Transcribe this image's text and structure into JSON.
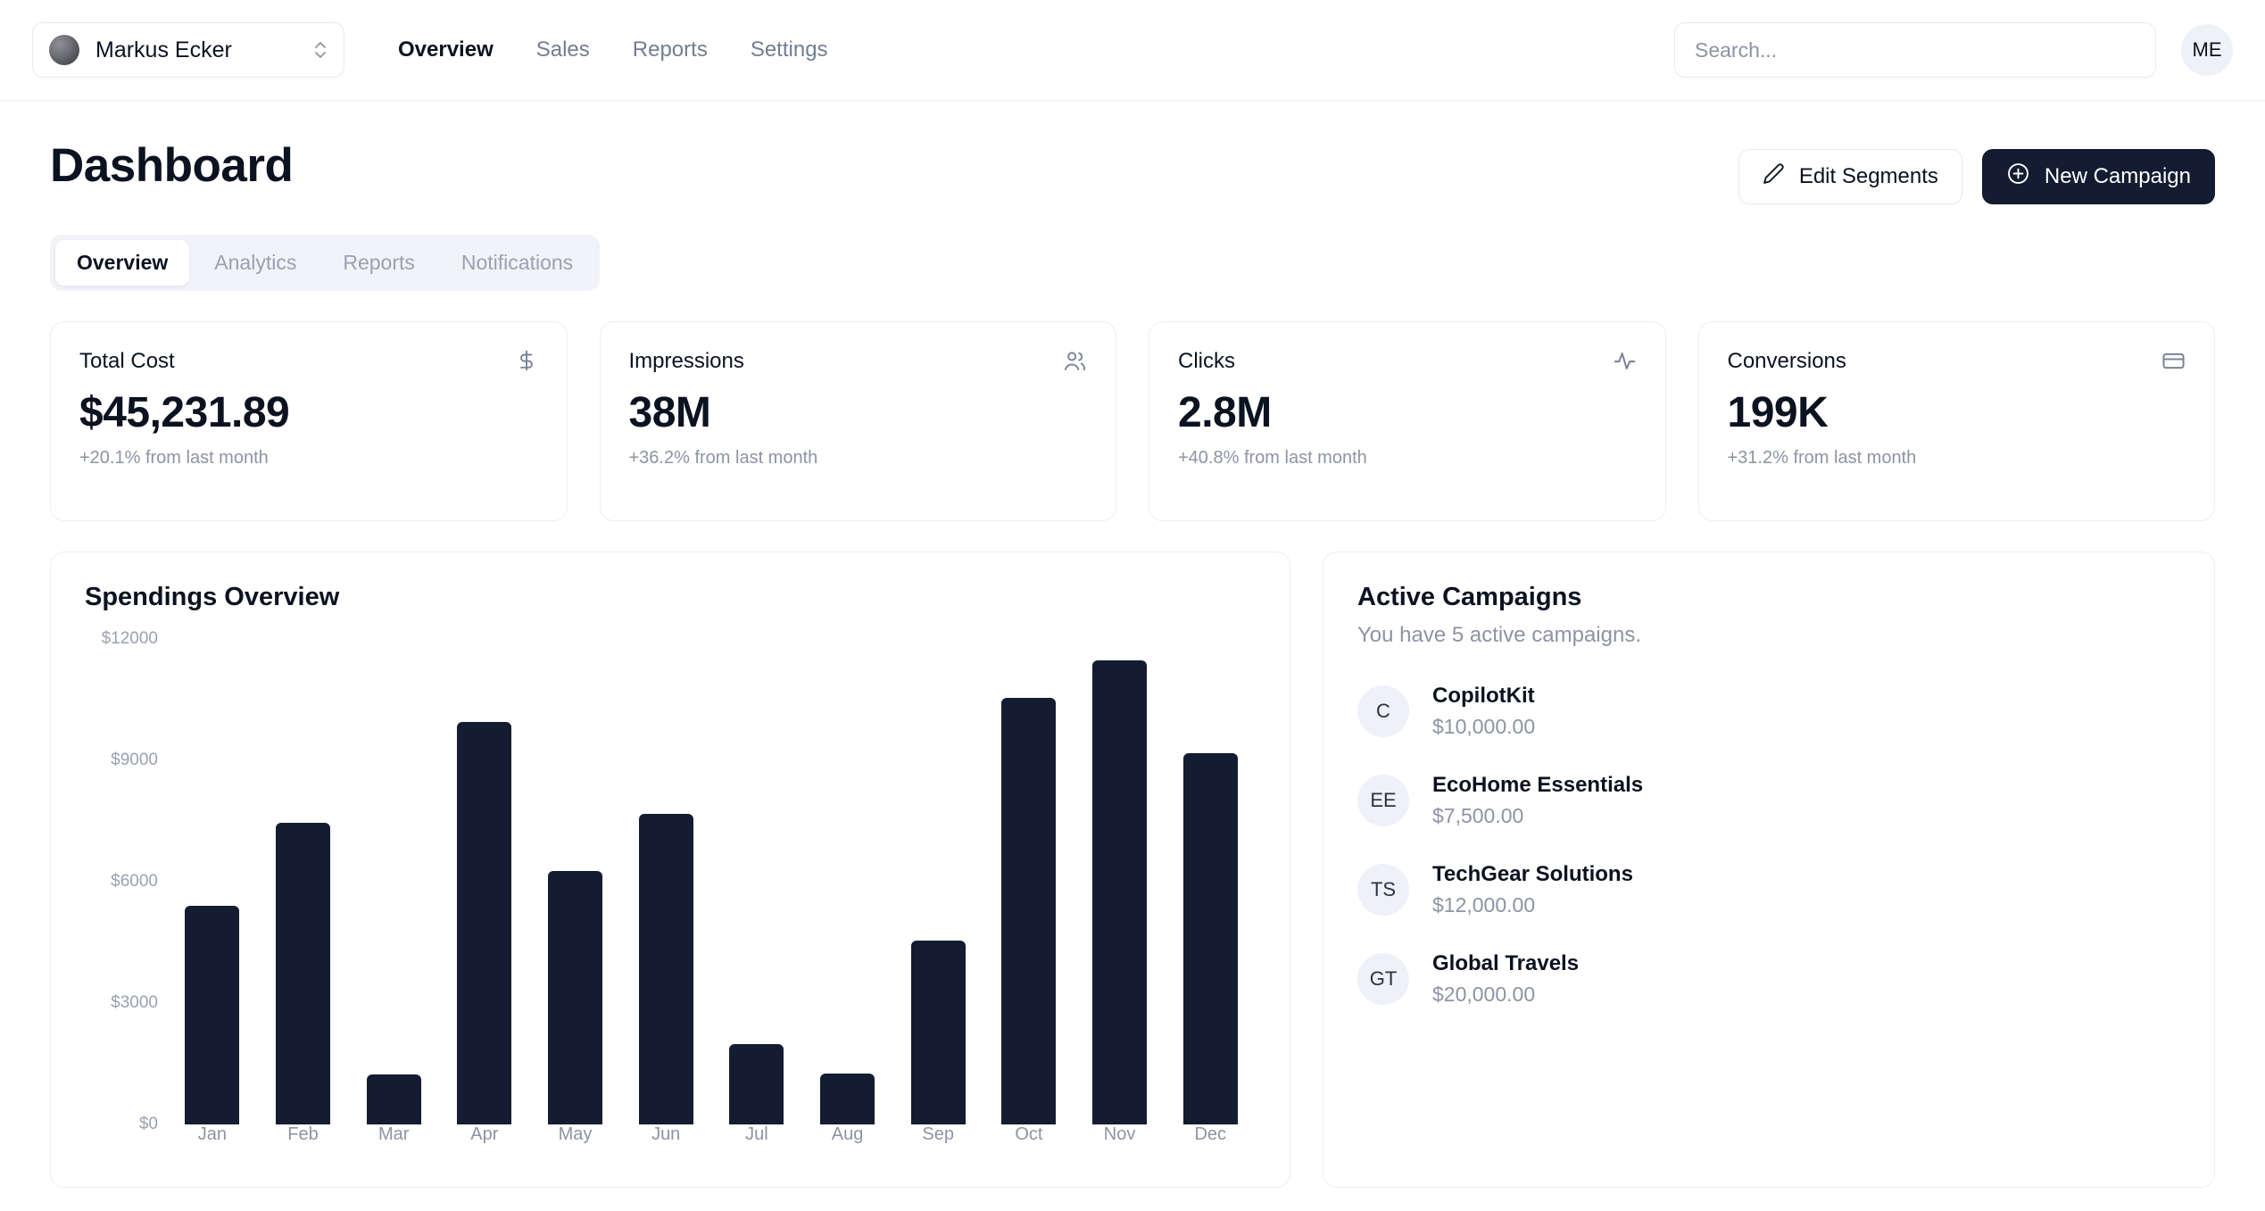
{
  "topbar": {
    "org_name": "Markus Ecker",
    "org_avatar_icon": "user-avatar-gradient",
    "switcher_icon": "chevron-up-down-icon",
    "nav": [
      {
        "label": "Overview",
        "active": true
      },
      {
        "label": "Sales",
        "active": false
      },
      {
        "label": "Reports",
        "active": false
      },
      {
        "label": "Settings",
        "active": false
      }
    ],
    "search_placeholder": "Search...",
    "search_value": "",
    "user_initials": "ME"
  },
  "header": {
    "title": "Dashboard",
    "edit_segments_label": "Edit Segments",
    "edit_segments_icon": "pencil-icon",
    "new_campaign_label": "New Campaign",
    "new_campaign_icon": "plus-circle-icon"
  },
  "tabs": [
    {
      "label": "Overview",
      "active": true
    },
    {
      "label": "Analytics",
      "active": false
    },
    {
      "label": "Reports",
      "active": false
    },
    {
      "label": "Notifications",
      "active": false
    }
  ],
  "kpis": [
    {
      "label": "Total Cost",
      "value": "$45,231.89",
      "delta": "+20.1% from last month",
      "icon": "dollar-icon"
    },
    {
      "label": "Impressions",
      "value": "38M",
      "delta": "+36.2% from last month",
      "icon": "users-icon"
    },
    {
      "label": "Clicks",
      "value": "2.8M",
      "delta": "+40.8% from last month",
      "icon": "activity-icon"
    },
    {
      "label": "Conversions",
      "value": "199K",
      "delta": "+31.2% from last month",
      "icon": "credit-card-icon"
    }
  ],
  "spendings": {
    "title": "Spendings Overview"
  },
  "campaigns": {
    "title": "Active Campaigns",
    "subtitle": "You have 5 active campaigns.",
    "items": [
      {
        "initials": "C",
        "name": "CopilotKit",
        "amount": "$10,000.00"
      },
      {
        "initials": "EE",
        "name": "EcoHome Essentials",
        "amount": "$7,500.00"
      },
      {
        "initials": "TS",
        "name": "TechGear Solutions",
        "amount": "$12,000.00"
      },
      {
        "initials": "GT",
        "name": "Global Travels",
        "amount": "$20,000.00"
      }
    ]
  },
  "colors": {
    "bar": "#131c31",
    "primary_button": "#131c31",
    "muted_text": "#8d93a3",
    "card_border": "#eceef2",
    "tab_strip": "#f1f3f8"
  },
  "chart_data": {
    "type": "bar",
    "title": "Spendings Overview",
    "xlabel": "",
    "ylabel": "",
    "categories": [
      "Jan",
      "Feb",
      "Mar",
      "Apr",
      "May",
      "Jun",
      "Jul",
      "Aug",
      "Sep",
      "Oct",
      "Nov",
      "Dec"
    ],
    "values": [
      5400,
      7450,
      1230,
      9950,
      6270,
      7680,
      1990,
      1250,
      4540,
      10550,
      11470,
      9170
    ],
    "ylim": [
      0,
      12000
    ],
    "ytick_labels": [
      "$0",
      "$3000",
      "$6000",
      "$9000",
      "$12000"
    ],
    "yticks": [
      0,
      3000,
      6000,
      9000,
      12000
    ],
    "grid": false,
    "legend": false,
    "bar_color": "#131c31"
  }
}
